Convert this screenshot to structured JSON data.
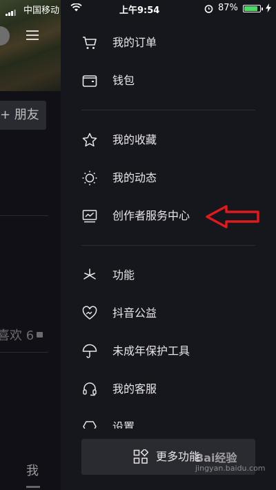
{
  "status_bar": {
    "carrier": "中国移动",
    "time": "上午9:54",
    "battery_percent": "87%",
    "battery_level": 0.87,
    "battery_color": "#4cd964"
  },
  "background": {
    "add_friend": "+ 朋友",
    "likes": "喜欢 6",
    "me_tab": "我"
  },
  "drawer": {
    "items": [
      {
        "label": "我的订单",
        "icon": "cart-icon"
      },
      {
        "label": "钱包",
        "icon": "wallet-icon"
      },
      {
        "label": "我的收藏",
        "icon": "star-icon"
      },
      {
        "label": "我的动态",
        "icon": "sun-icon"
      },
      {
        "label": "创作者服务中心",
        "icon": "chart-monitor-icon"
      },
      {
        "label": "功能",
        "icon": "sparkle-icon"
      },
      {
        "label": "抖音公益",
        "icon": "charity-heart-icon"
      },
      {
        "label": "未成年保护工具",
        "icon": "umbrella-icon"
      },
      {
        "label": "我的客服",
        "icon": "headset-icon"
      },
      {
        "label": "设置",
        "icon": "settings-icon"
      }
    ],
    "more_label": "更多功能",
    "more_icon": "grid-icon"
  },
  "annotation": {
    "arrow_color": "#e0191c"
  },
  "watermark": {
    "text": "Bai经验",
    "url": "jingyan.baidu.com"
  }
}
